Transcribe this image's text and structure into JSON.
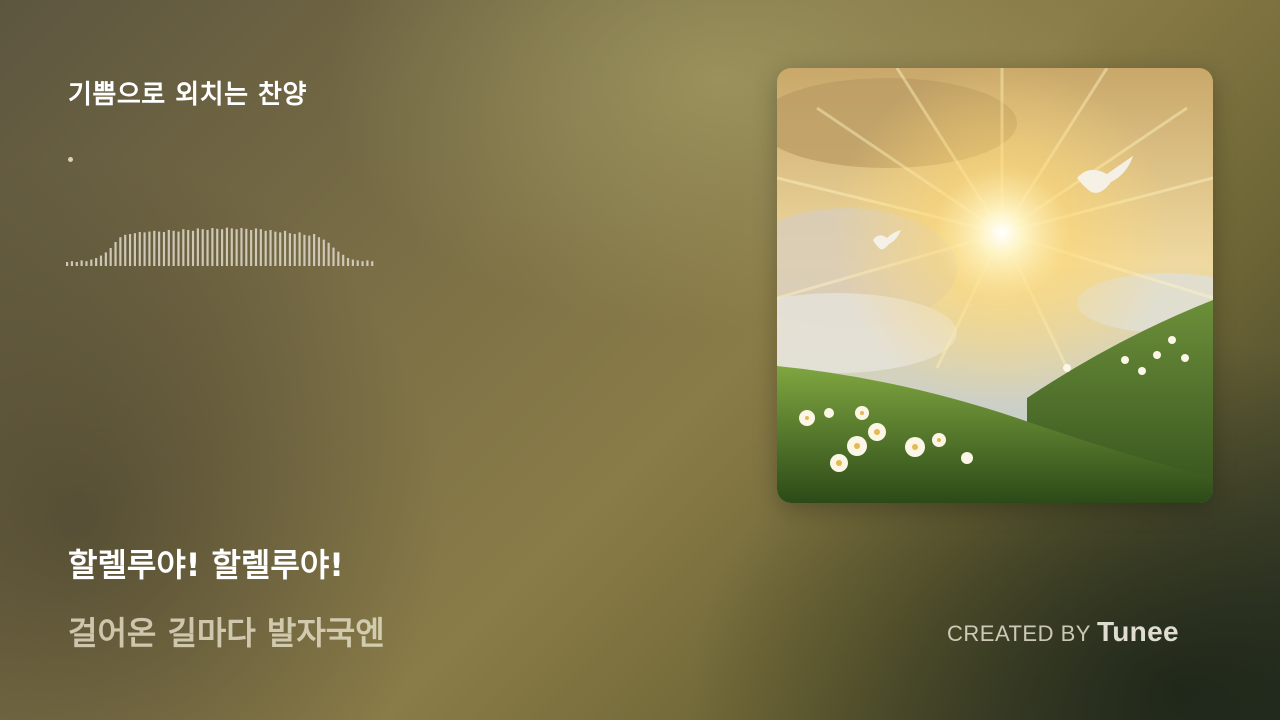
{
  "player": {
    "song_title": "기쁨으로 외치는 찬양",
    "lyric_current": "할렐루야! 할렐루야!",
    "lyric_next": "걸어온 길마다 발자국엔",
    "waveform_levels": [
      0.1,
      0.12,
      0.1,
      0.14,
      0.12,
      0.16,
      0.2,
      0.26,
      0.34,
      0.45,
      0.6,
      0.72,
      0.78,
      0.8,
      0.82,
      0.85,
      0.84,
      0.86,
      0.88,
      0.86,
      0.85,
      0.9,
      0.88,
      0.86,
      0.92,
      0.9,
      0.88,
      0.94,
      0.92,
      0.9,
      0.95,
      0.93,
      0.92,
      0.96,
      0.94,
      0.92,
      0.95,
      0.93,
      0.9,
      0.94,
      0.92,
      0.88,
      0.9,
      0.86,
      0.84,
      0.88,
      0.82,
      0.8,
      0.84,
      0.78,
      0.76,
      0.8,
      0.72,
      0.66,
      0.58,
      0.46,
      0.36,
      0.28,
      0.2,
      0.16,
      0.14,
      0.12,
      0.14,
      0.12
    ]
  },
  "credit": {
    "prefix": "CREATED BY",
    "brand": "Tunee"
  }
}
